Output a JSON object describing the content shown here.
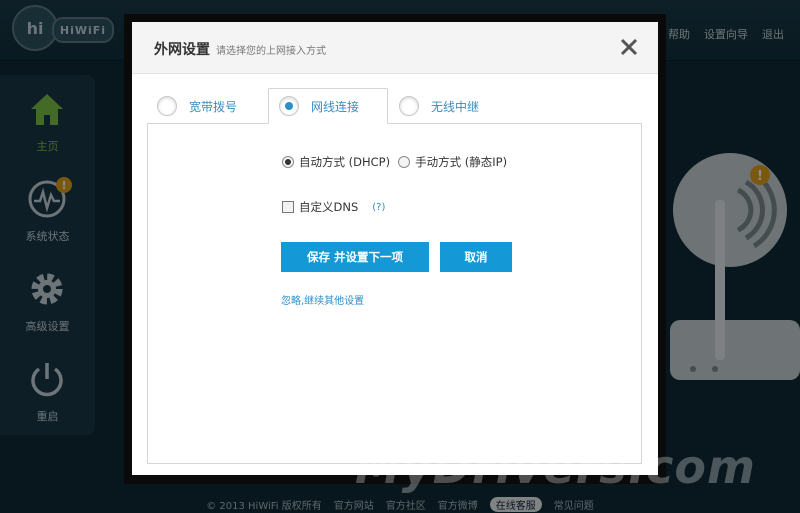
{
  "app": {
    "logo_text": "HiWiFi",
    "header_links": [
      "帮助",
      "设置向导",
      "退出"
    ]
  },
  "sidebar": {
    "items": [
      {
        "label": "主页",
        "icon": "home-icon",
        "active": true
      },
      {
        "label": "系统状态",
        "icon": "pulse-icon",
        "badge": "!"
      },
      {
        "label": "高级设置",
        "icon": "gear-icon"
      },
      {
        "label": "重启",
        "icon": "power-icon"
      }
    ]
  },
  "router": {
    "badge": "!"
  },
  "footer": {
    "items": [
      "© 2013 HiWiFi 版权所有",
      "官方网站",
      "官方社区",
      "官方微博",
      "在线客服",
      "常见问题"
    ]
  },
  "dialog": {
    "title": "外网设置",
    "subtitle": "请选择您的上网接入方式",
    "tabs": [
      {
        "label": "宽带拨号",
        "selected": false
      },
      {
        "label": "网线连接",
        "selected": true
      },
      {
        "label": "无线中继",
        "selected": false
      }
    ],
    "mode_options": [
      {
        "label": "自动方式 (DHCP)",
        "selected": true
      },
      {
        "label": "手动方式 (静态IP)",
        "selected": false
      }
    ],
    "custom_dns": {
      "label": "自定义DNS",
      "help": "(?)",
      "checked": false
    },
    "save_button": "保存 并设置下一项",
    "cancel_button": "取消",
    "skip_link": "忽略,继续其他设置"
  },
  "watermark": "MyDrivers.com",
  "colors": {
    "accent": "#1599d6",
    "link": "#2c8fc7",
    "active_nav": "#7dc24a",
    "badge": "#e0a11c"
  }
}
